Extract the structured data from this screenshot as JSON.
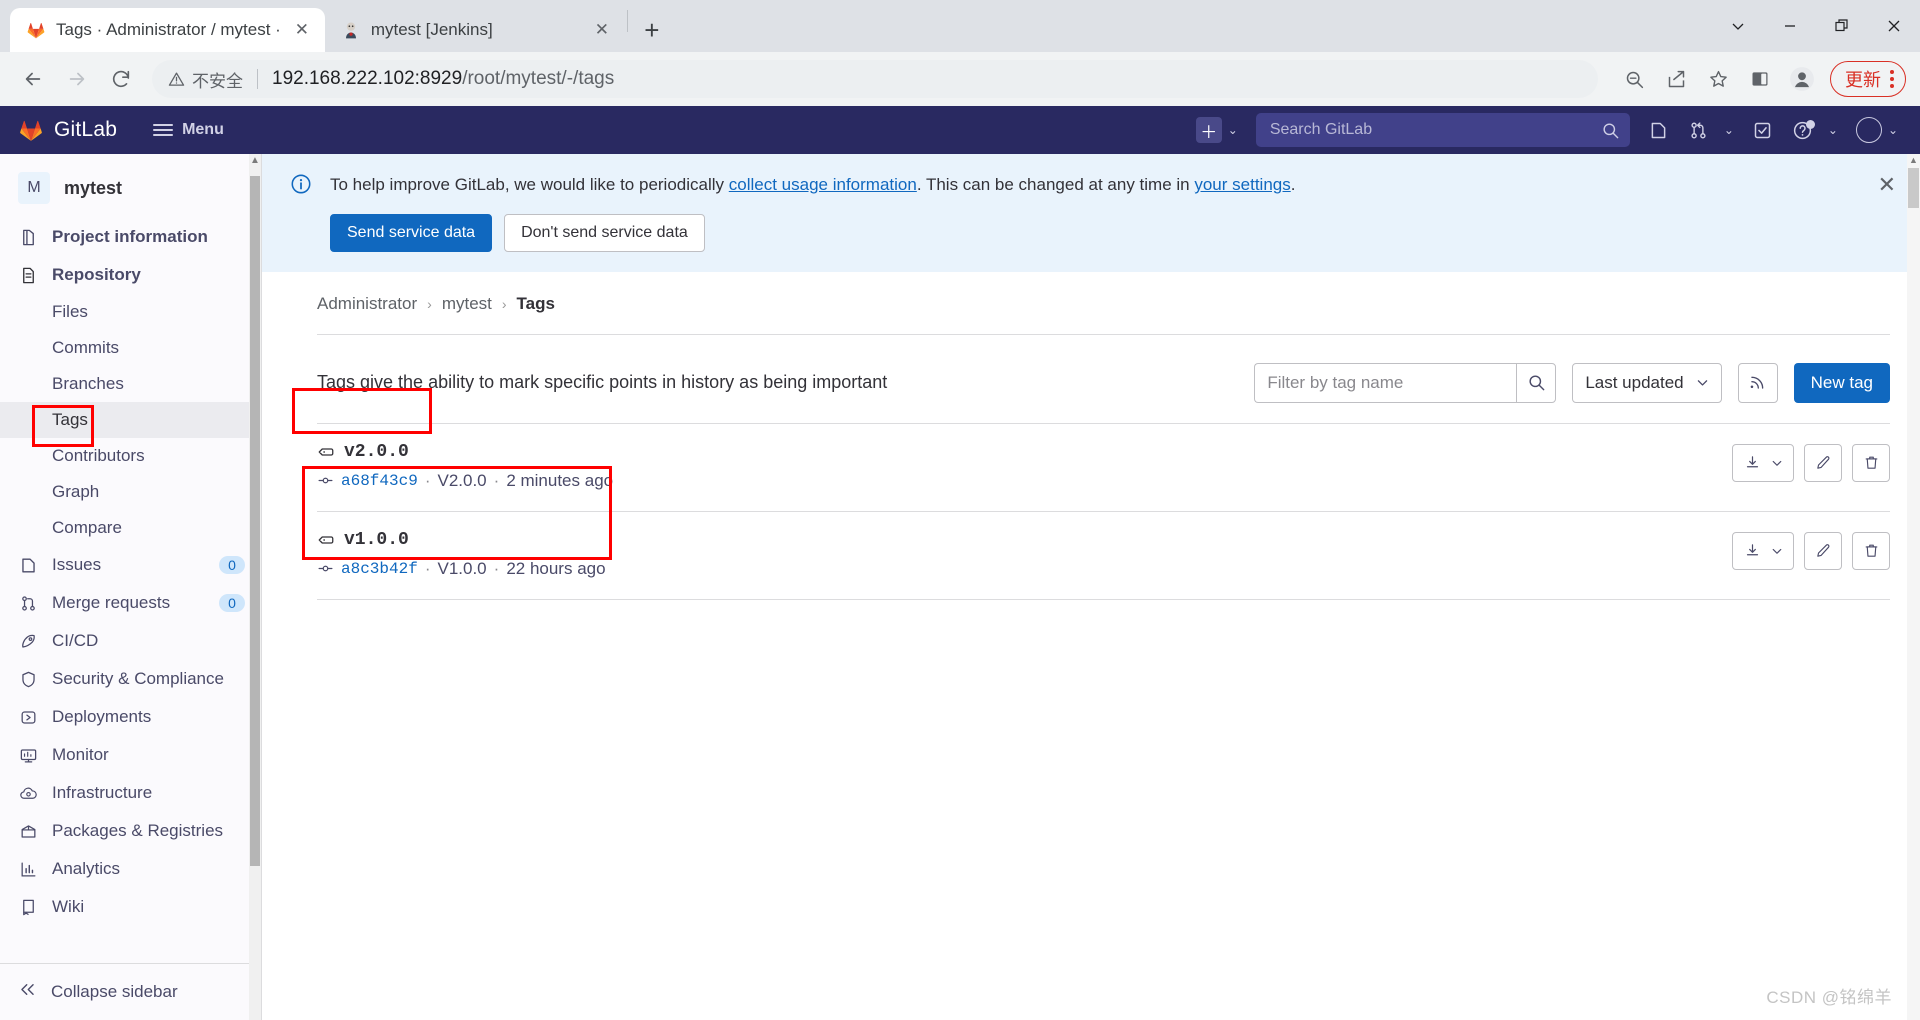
{
  "browser": {
    "tabs": [
      {
        "title": "Tags · Administrator / mytest ·",
        "favicon": "gitlab-icon",
        "active": true
      },
      {
        "title": "mytest [Jenkins]",
        "favicon": "jenkins-icon",
        "active": false
      }
    ],
    "new_tab_label": "+",
    "window_controls": {
      "list_tabs": "⌄",
      "minimize": "—",
      "restore": "❐",
      "close": "✕"
    },
    "nav": {
      "back": "←",
      "forward": "→",
      "reload": "⟳"
    },
    "omnibox": {
      "security_label": "不安全",
      "url_host": "192.168.222.102:8929",
      "url_path": "/root/mytest/-/tags"
    },
    "toolbar_icons": [
      "zoom-out-icon",
      "share-icon",
      "bookmark-star-icon",
      "side-panel-icon",
      "profile-icon"
    ],
    "update_button": "更新"
  },
  "gitlab": {
    "brand": "GitLab",
    "menu_label": "Menu",
    "search_placeholder": "Search GitLab",
    "nav_icons": [
      "create-new-icon",
      "search-icon",
      "issues-icon",
      "merge-requests-icon",
      "todos-icon",
      "help-icon",
      "user-avatar"
    ]
  },
  "sidebar": {
    "project": {
      "initial": "M",
      "name": "mytest"
    },
    "items": [
      {
        "label": "Project information",
        "icon": "project-info-icon",
        "type": "top"
      },
      {
        "label": "Repository",
        "icon": "repository-icon",
        "type": "top",
        "active_parent": true
      },
      {
        "label": "Files",
        "type": "sub"
      },
      {
        "label": "Commits",
        "type": "sub"
      },
      {
        "label": "Branches",
        "type": "sub"
      },
      {
        "label": "Tags",
        "type": "sub",
        "active": true
      },
      {
        "label": "Contributors",
        "type": "sub"
      },
      {
        "label": "Graph",
        "type": "sub"
      },
      {
        "label": "Compare",
        "type": "sub"
      },
      {
        "label": "Issues",
        "icon": "issues-icon",
        "type": "top",
        "badge": "0"
      },
      {
        "label": "Merge requests",
        "icon": "merge-requests-icon",
        "type": "top",
        "badge": "0"
      },
      {
        "label": "CI/CD",
        "icon": "rocket-icon",
        "type": "top"
      },
      {
        "label": "Security & Compliance",
        "icon": "shield-icon",
        "type": "top"
      },
      {
        "label": "Deployments",
        "icon": "deployments-icon",
        "type": "top"
      },
      {
        "label": "Monitor",
        "icon": "monitor-icon",
        "type": "top"
      },
      {
        "label": "Infrastructure",
        "icon": "infrastructure-icon",
        "type": "top"
      },
      {
        "label": "Packages & Registries",
        "icon": "package-icon",
        "type": "top"
      },
      {
        "label": "Analytics",
        "icon": "analytics-icon",
        "type": "top"
      },
      {
        "label": "Wiki",
        "icon": "wiki-icon",
        "type": "top"
      }
    ],
    "collapse_label": "Collapse sidebar"
  },
  "alert": {
    "text_before": "To help improve GitLab, we would like to periodically ",
    "link1": "collect usage information",
    "text_middle": ". This can be changed at any time in ",
    "link2": "your settings",
    "text_after": ".",
    "send_label": "Send service data",
    "dont_send_label": "Don't send service data",
    "close": "✕"
  },
  "breadcrumb": {
    "items": [
      "Administrator",
      "mytest",
      "Tags"
    ],
    "separator": "›"
  },
  "tags_page": {
    "description": "Tags give the ability to mark specific points in history as being important",
    "filter_placeholder": "Filter by tag name",
    "sort_label": "Last updated",
    "new_tag_label": "New tag",
    "rows": [
      {
        "name": "v2.0.0",
        "sha": "a68f43c9",
        "message": "V2.0.0",
        "time": "2 minutes ago"
      },
      {
        "name": "v1.0.0",
        "sha": "a8c3b42f",
        "message": "V1.0.0",
        "time": "22 hours ago"
      }
    ]
  },
  "watermark": "CSDN @铭绵羊",
  "colors": {
    "gitlab_navy": "#292961",
    "primary_blue": "#1068bf",
    "annotation_red": "#ff0000",
    "alert_bg": "#e9f3fc"
  }
}
